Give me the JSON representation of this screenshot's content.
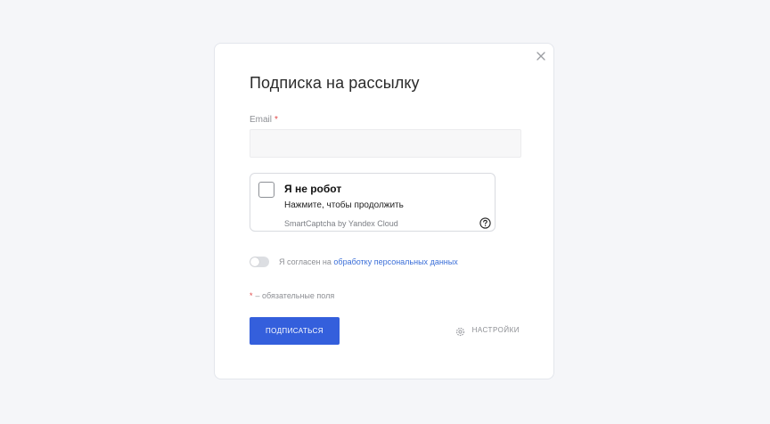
{
  "modal": {
    "title": "Подписка на рассылку",
    "close_icon": "close-icon"
  },
  "form": {
    "email_label": "Email",
    "required_mark": "*",
    "email_value": "",
    "email_placeholder": ""
  },
  "captcha": {
    "title": "Я не робот",
    "subtitle": "Нажмите, чтобы продолжить",
    "brand": "SmartCaptcha by Yandex Cloud",
    "help_icon": "question-circle-icon"
  },
  "consent": {
    "text": "Я согласен на",
    "link": "обработку персональных данных",
    "toggled": false
  },
  "required_note": {
    "mark": "*",
    "text": "– обязательные поля"
  },
  "actions": {
    "submit_label": "ПОДПИСАТЬСЯ",
    "settings_label": "НАСТРОЙКИ",
    "settings_icon": "gear-icon"
  },
  "colors": {
    "accent": "#345fdc",
    "link": "#3a6ed8",
    "required": "#e04848",
    "background": "#f5f6f9"
  }
}
